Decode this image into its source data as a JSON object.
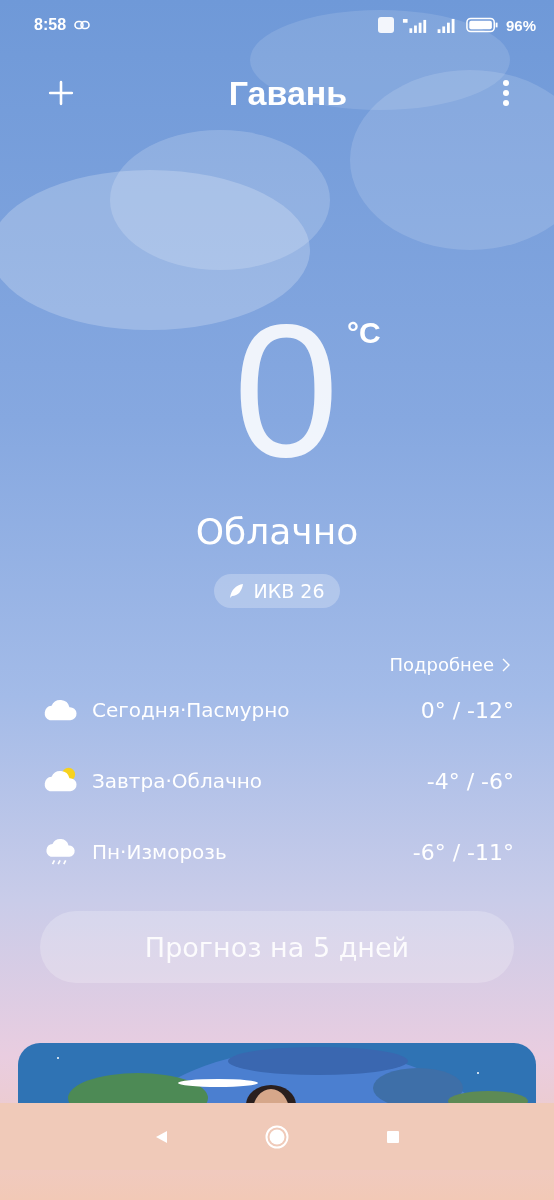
{
  "status_bar": {
    "time": "8:58",
    "battery_text": "96%"
  },
  "header": {
    "title": "Гавань"
  },
  "current": {
    "temperature": "0",
    "unit": "°C",
    "condition": "Облачно",
    "aqi": "ИКВ 26"
  },
  "forecast": {
    "more_link": "Подробнее",
    "days": [
      {
        "kind": "cloudy",
        "label": "Сегодня·Пасмурно",
        "range": "0° / -12°"
      },
      {
        "kind": "partly_cloudy",
        "label": "Завтра·Облачно",
        "range": "-4° / -6°"
      },
      {
        "kind": "sleet",
        "label": "Пн·Изморозь",
        "range": "-6° / -11°"
      }
    ],
    "button": "Прогноз на 5 дней"
  }
}
